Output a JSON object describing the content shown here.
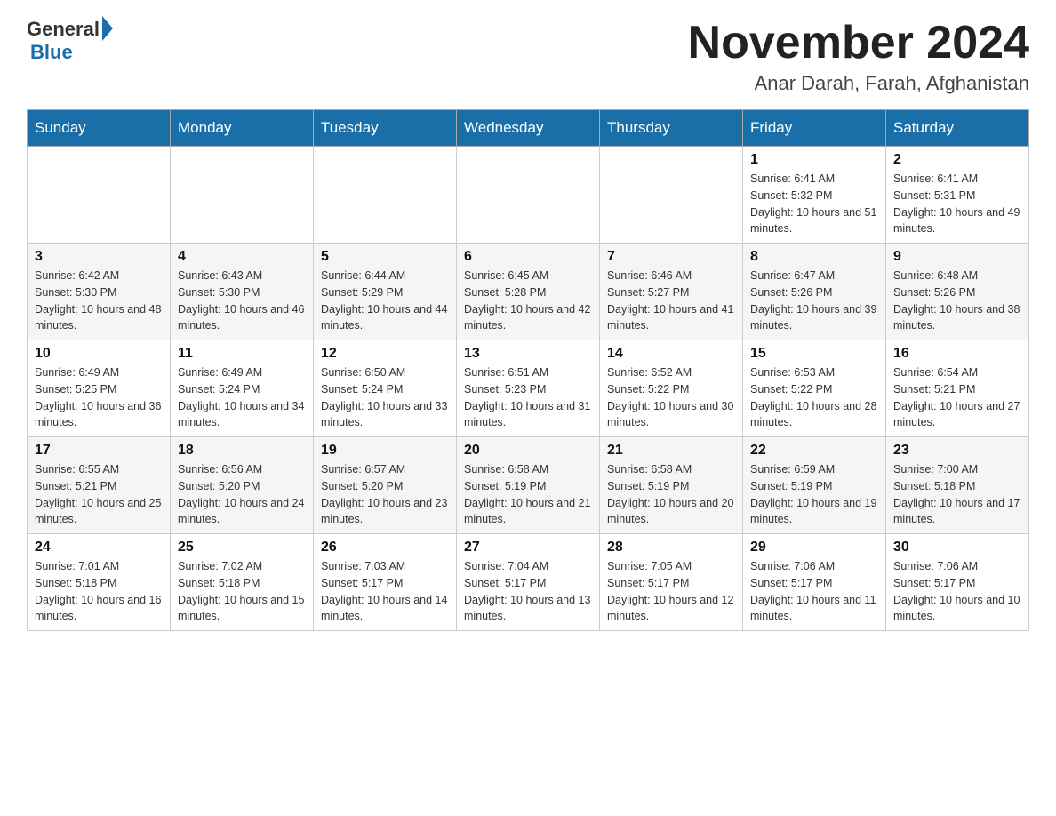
{
  "header": {
    "logo_general": "General",
    "logo_blue": "Blue",
    "month_title": "November 2024",
    "location": "Anar Darah, Farah, Afghanistan"
  },
  "days_of_week": [
    "Sunday",
    "Monday",
    "Tuesday",
    "Wednesday",
    "Thursday",
    "Friday",
    "Saturday"
  ],
  "weeks": [
    [
      {
        "day": "",
        "info": ""
      },
      {
        "day": "",
        "info": ""
      },
      {
        "day": "",
        "info": ""
      },
      {
        "day": "",
        "info": ""
      },
      {
        "day": "",
        "info": ""
      },
      {
        "day": "1",
        "info": "Sunrise: 6:41 AM\nSunset: 5:32 PM\nDaylight: 10 hours and 51 minutes."
      },
      {
        "day": "2",
        "info": "Sunrise: 6:41 AM\nSunset: 5:31 PM\nDaylight: 10 hours and 49 minutes."
      }
    ],
    [
      {
        "day": "3",
        "info": "Sunrise: 6:42 AM\nSunset: 5:30 PM\nDaylight: 10 hours and 48 minutes."
      },
      {
        "day": "4",
        "info": "Sunrise: 6:43 AM\nSunset: 5:30 PM\nDaylight: 10 hours and 46 minutes."
      },
      {
        "day": "5",
        "info": "Sunrise: 6:44 AM\nSunset: 5:29 PM\nDaylight: 10 hours and 44 minutes."
      },
      {
        "day": "6",
        "info": "Sunrise: 6:45 AM\nSunset: 5:28 PM\nDaylight: 10 hours and 42 minutes."
      },
      {
        "day": "7",
        "info": "Sunrise: 6:46 AM\nSunset: 5:27 PM\nDaylight: 10 hours and 41 minutes."
      },
      {
        "day": "8",
        "info": "Sunrise: 6:47 AM\nSunset: 5:26 PM\nDaylight: 10 hours and 39 minutes."
      },
      {
        "day": "9",
        "info": "Sunrise: 6:48 AM\nSunset: 5:26 PM\nDaylight: 10 hours and 38 minutes."
      }
    ],
    [
      {
        "day": "10",
        "info": "Sunrise: 6:49 AM\nSunset: 5:25 PM\nDaylight: 10 hours and 36 minutes."
      },
      {
        "day": "11",
        "info": "Sunrise: 6:49 AM\nSunset: 5:24 PM\nDaylight: 10 hours and 34 minutes."
      },
      {
        "day": "12",
        "info": "Sunrise: 6:50 AM\nSunset: 5:24 PM\nDaylight: 10 hours and 33 minutes."
      },
      {
        "day": "13",
        "info": "Sunrise: 6:51 AM\nSunset: 5:23 PM\nDaylight: 10 hours and 31 minutes."
      },
      {
        "day": "14",
        "info": "Sunrise: 6:52 AM\nSunset: 5:22 PM\nDaylight: 10 hours and 30 minutes."
      },
      {
        "day": "15",
        "info": "Sunrise: 6:53 AM\nSunset: 5:22 PM\nDaylight: 10 hours and 28 minutes."
      },
      {
        "day": "16",
        "info": "Sunrise: 6:54 AM\nSunset: 5:21 PM\nDaylight: 10 hours and 27 minutes."
      }
    ],
    [
      {
        "day": "17",
        "info": "Sunrise: 6:55 AM\nSunset: 5:21 PM\nDaylight: 10 hours and 25 minutes."
      },
      {
        "day": "18",
        "info": "Sunrise: 6:56 AM\nSunset: 5:20 PM\nDaylight: 10 hours and 24 minutes."
      },
      {
        "day": "19",
        "info": "Sunrise: 6:57 AM\nSunset: 5:20 PM\nDaylight: 10 hours and 23 minutes."
      },
      {
        "day": "20",
        "info": "Sunrise: 6:58 AM\nSunset: 5:19 PM\nDaylight: 10 hours and 21 minutes."
      },
      {
        "day": "21",
        "info": "Sunrise: 6:58 AM\nSunset: 5:19 PM\nDaylight: 10 hours and 20 minutes."
      },
      {
        "day": "22",
        "info": "Sunrise: 6:59 AM\nSunset: 5:19 PM\nDaylight: 10 hours and 19 minutes."
      },
      {
        "day": "23",
        "info": "Sunrise: 7:00 AM\nSunset: 5:18 PM\nDaylight: 10 hours and 17 minutes."
      }
    ],
    [
      {
        "day": "24",
        "info": "Sunrise: 7:01 AM\nSunset: 5:18 PM\nDaylight: 10 hours and 16 minutes."
      },
      {
        "day": "25",
        "info": "Sunrise: 7:02 AM\nSunset: 5:18 PM\nDaylight: 10 hours and 15 minutes."
      },
      {
        "day": "26",
        "info": "Sunrise: 7:03 AM\nSunset: 5:17 PM\nDaylight: 10 hours and 14 minutes."
      },
      {
        "day": "27",
        "info": "Sunrise: 7:04 AM\nSunset: 5:17 PM\nDaylight: 10 hours and 13 minutes."
      },
      {
        "day": "28",
        "info": "Sunrise: 7:05 AM\nSunset: 5:17 PM\nDaylight: 10 hours and 12 minutes."
      },
      {
        "day": "29",
        "info": "Sunrise: 7:06 AM\nSunset: 5:17 PM\nDaylight: 10 hours and 11 minutes."
      },
      {
        "day": "30",
        "info": "Sunrise: 7:06 AM\nSunset: 5:17 PM\nDaylight: 10 hours and 10 minutes."
      }
    ]
  ]
}
